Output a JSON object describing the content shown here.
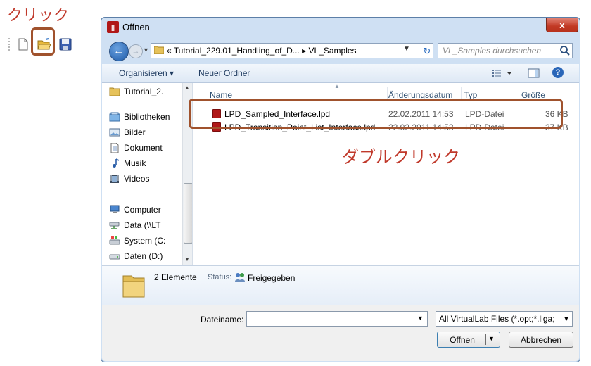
{
  "annotations": {
    "click": "クリック",
    "double_click": "ダブルクリック"
  },
  "toolbar": {
    "icons": [
      "new-document-icon",
      "open-folder-icon",
      "save-disk-icon"
    ]
  },
  "dialog": {
    "title": "Öffnen",
    "close_label": "x",
    "address_path": "« Tutorial_229.01_Handling_of_D... ▸ VL_Samples",
    "search_placeholder": "VL_Samples durchsuchen",
    "commands": {
      "organize": "Organisieren ▾",
      "new_folder": "Neuer Ordner"
    },
    "nav_items": [
      {
        "label": "Tutorial_2.",
        "icon": "folder-icon"
      },
      {
        "label": "Bibliotheken",
        "icon": "libraries-icon"
      },
      {
        "label": "Bilder",
        "icon": "pictures-icon"
      },
      {
        "label": "Dokument",
        "icon": "documents-icon"
      },
      {
        "label": "Musik",
        "icon": "music-icon"
      },
      {
        "label": "Videos",
        "icon": "videos-icon"
      },
      {
        "label": "Computer",
        "icon": "computer-icon"
      },
      {
        "label": "Data (\\\\LT",
        "icon": "network-drive-icon"
      },
      {
        "label": "System (C:",
        "icon": "system-drive-icon"
      },
      {
        "label": "Daten (D:)",
        "icon": "drive-icon"
      }
    ],
    "columns": {
      "name": "Name",
      "date": "Änderungsdatum",
      "type": "Typ",
      "size": "Größe"
    },
    "files": [
      {
        "name": "LPD_Sampled_Interface.lpd",
        "date": "22.02.2011 14:53",
        "type": "LPD-Datei",
        "size": "36 KB"
      },
      {
        "name": "LPD_Transition_Point_List_Interface.lpd",
        "date": "22.02.2011 14:53",
        "type": "LPD-Datei",
        "size": "37 KB"
      }
    ],
    "details": {
      "count": "2 Elemente",
      "status_label": "Status:",
      "status_value": "Freigegeben"
    },
    "filename_label": "Dateiname:",
    "filename_value": "",
    "filter_value": "All VirtualLab Files  (*.opt;*.llga;",
    "open_button": "Öffnen",
    "cancel_button": "Abbrechen"
  }
}
